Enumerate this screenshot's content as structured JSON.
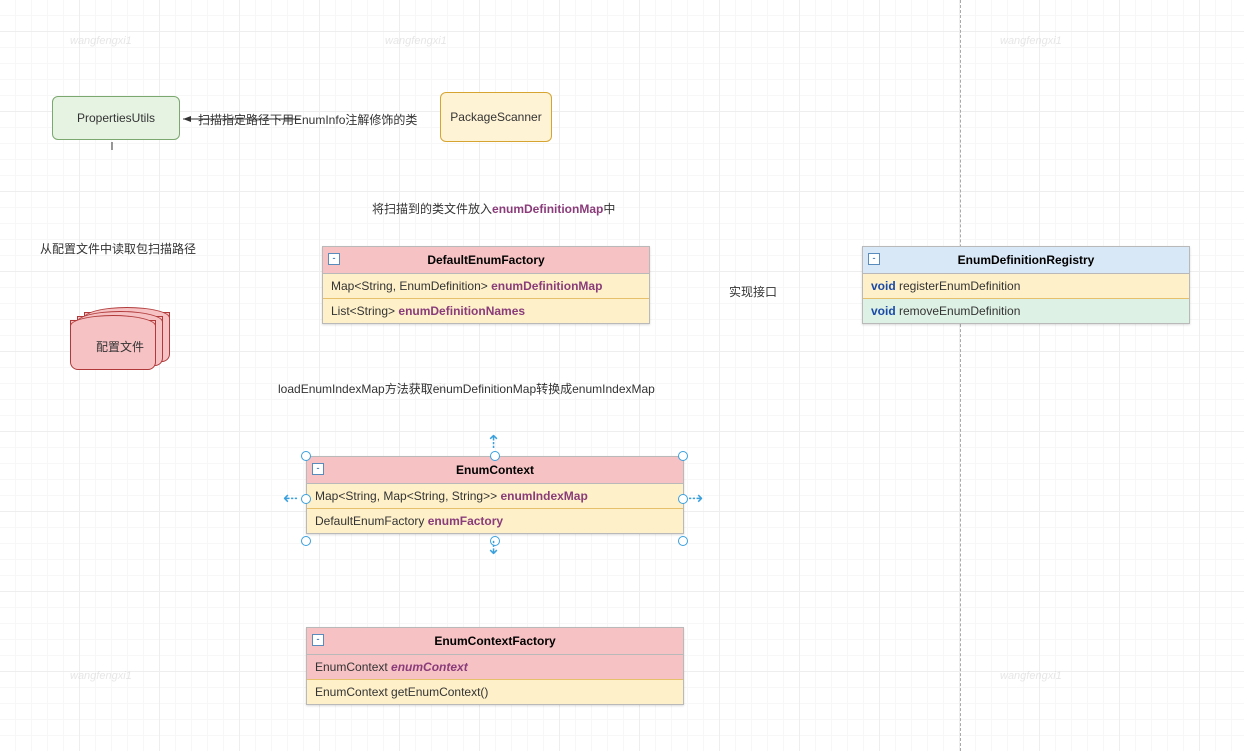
{
  "watermarks": [
    "wangfengxi1",
    "wangfengxi1",
    "wangfengxi1",
    "wangfengxi1",
    "wangfengxi1",
    "wangfengxi1"
  ],
  "nodes": {
    "propertiesUtils": "PropertiesUtils",
    "packageScanner": "PackageScanner",
    "configFile": "配置文件"
  },
  "classes": {
    "defaultEnumFactory": {
      "title": "DefaultEnumFactory",
      "rows": [
        {
          "type": "Map<String, EnumDefinition>",
          "name": "enumDefinitionMap"
        },
        {
          "type": "List<String>",
          "name": "enumDefinitionNames"
        }
      ]
    },
    "enumDefinitionRegistry": {
      "title": "EnumDefinitionRegistry",
      "rows": [
        {
          "kw": "void",
          "name": "registerEnumDefinition"
        },
        {
          "kw": "void",
          "name": "removeEnumDefinition"
        }
      ]
    },
    "enumContext": {
      "title": "EnumContext",
      "rows": [
        {
          "type": "Map<String, Map<String, String>>",
          "name": "enumIndexMap"
        },
        {
          "type": "DefaultEnumFactory",
          "name": "enumFactory"
        }
      ]
    },
    "enumContextFactory": {
      "title": "EnumContextFactory",
      "rows": [
        {
          "type": "EnumContext",
          "name_i": "enumContext"
        },
        {
          "type": "EnumContext",
          "method": "getEnumContext()"
        }
      ]
    }
  },
  "labels": {
    "scanPath": "扫描指定路径下用EnumInfo注解修饰的类",
    "putMap_pre": "将扫描到的类文件放入",
    "putMap_code": "enumDefinitionMap",
    "putMap_suf": "中",
    "readPath": "从配置文件中读取包扫描路径",
    "implInterface": "实现接口",
    "loadMap": "loadEnumIndexMap方法获取enumDefinitionMap转换成enumIndexMap"
  },
  "collapse": "-"
}
